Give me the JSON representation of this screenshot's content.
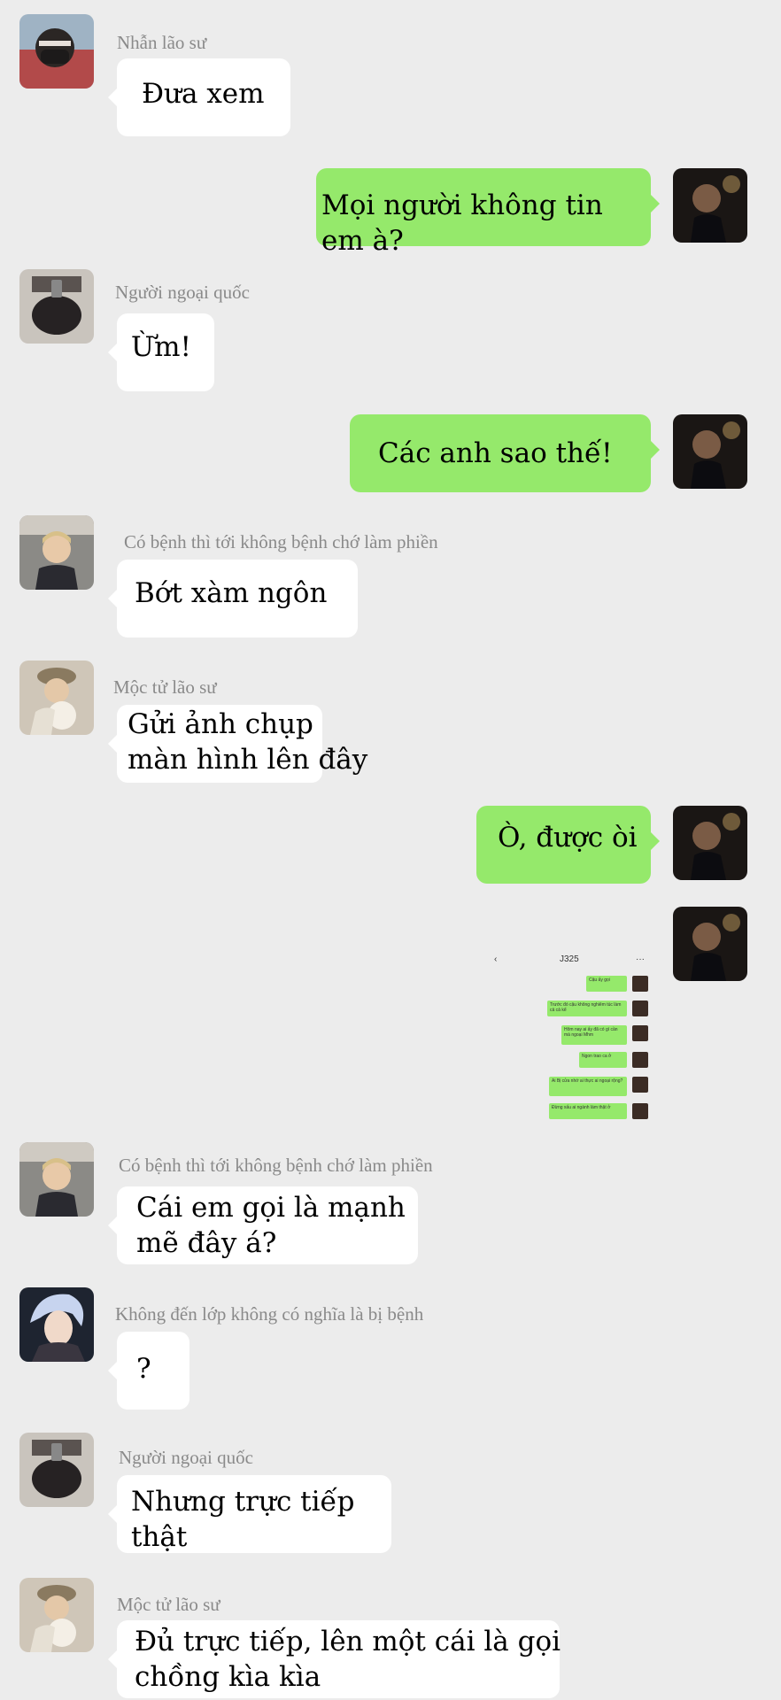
{
  "messages": [
    {
      "side": "left",
      "name": "Nhẫn lão sư",
      "lines": [
        "Đưa xem"
      ],
      "avatar": "avatar-masked-selfie-icon"
    },
    {
      "side": "right",
      "lines": [
        "Mọi người không tin em à?"
      ],
      "avatar": "avatar-self-icon"
    },
    {
      "side": "left",
      "name": "Người ngoại quốc",
      "lines": [
        "Ừm!"
      ],
      "avatar": "avatar-mirror-selfie-icon"
    },
    {
      "side": "right",
      "lines": [
        "Các anh sao thế!"
      ],
      "avatar": "avatar-self-icon"
    },
    {
      "side": "left",
      "name": "Có bệnh thì tới không bệnh chớ làm phiền",
      "lines": [
        "Bớt xàm ngôn"
      ],
      "avatar": "avatar-car-selfie-icon"
    },
    {
      "side": "left",
      "name": "Mộc tử lão sư",
      "lines": [
        "Gửi ảnh chụp",
        "màn hình lên đây"
      ],
      "avatar": "avatar-puppy-icon"
    },
    {
      "side": "right",
      "lines": [
        "Ò, được òi"
      ],
      "avatar": "avatar-self-icon"
    },
    {
      "side": "right",
      "type": "image",
      "avatar": "avatar-self-icon"
    },
    {
      "side": "left",
      "name": "Có bệnh thì tới không bệnh chớ làm phiền",
      "lines": [
        "Cái em gọi là mạnh",
        "mẽ đây á?"
      ],
      "avatar": "avatar-car-selfie-icon"
    },
    {
      "side": "left",
      "name": "Không đến lớp không có nghĩa là bị bệnh",
      "lines": [
        "?"
      ],
      "avatar": "avatar-silver-hair-icon"
    },
    {
      "side": "left",
      "name": "Người ngoại quốc",
      "lines": [
        "Nhưng trực tiếp thật"
      ],
      "avatar": "avatar-mirror-selfie-icon"
    },
    {
      "side": "left",
      "name": "Mộc tử lão sư",
      "lines": [
        "Đủ trực tiếp, lên một cái là gọi",
        "chồng kìa kìa"
      ],
      "avatar": "avatar-puppy-icon"
    }
  ],
  "screenshot": {
    "back": "‹",
    "title": "J325",
    "menu": "···",
    "rows": [
      "Cậu ấy gọi",
      "Trước đó cậu không nghiêm túc làm cả cả kể",
      "Hôm nay ai ấy đã có gì cần mà ngoại Mhm",
      "Ngon trao ca ở",
      "Ai Bị cửa nhớ ai thực ai ngoại rộng?",
      "Đừng xấu ai ngành làm thật ở"
    ]
  },
  "colors": {
    "background": "#ececec",
    "incoming": "#ffffff",
    "outgoing": "#95e96b",
    "name": "#8a8a8a"
  }
}
